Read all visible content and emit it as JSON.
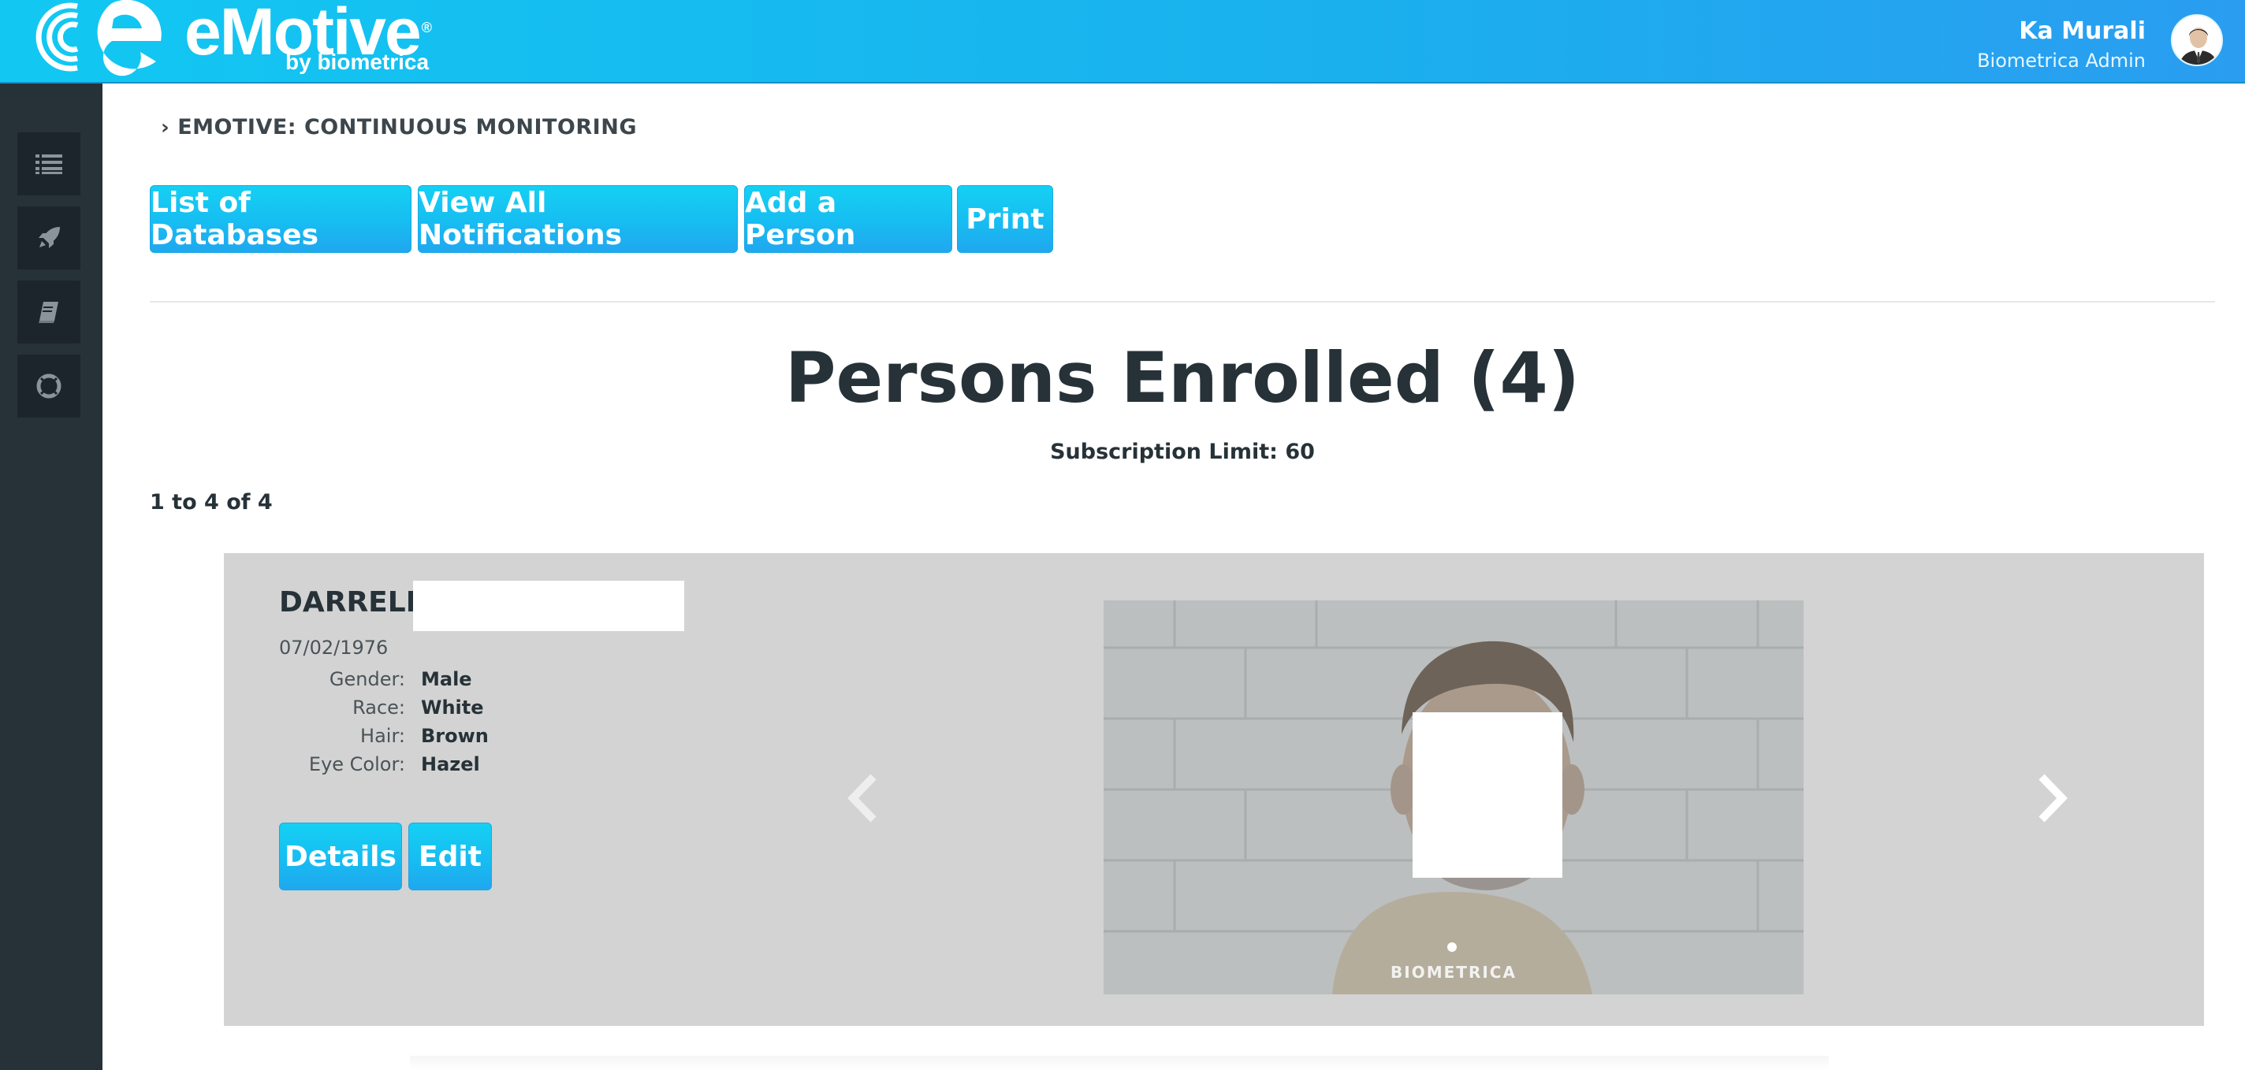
{
  "header": {
    "brand": "eMotive",
    "brand_reg": "®",
    "brand_sub": "by biometrica",
    "user_name": "Ka Murali",
    "user_role": "Biometrica Admin"
  },
  "sidebar": {
    "items": [
      {
        "icon": "list-icon"
      },
      {
        "icon": "rocket-icon"
      },
      {
        "icon": "book-icon"
      },
      {
        "icon": "lifebuoy-icon"
      }
    ]
  },
  "breadcrumb": {
    "label": "EMOTIVE: CONTINUOUS MONITORING"
  },
  "toolbar": {
    "list_databases": "List of Databases",
    "view_notifications": "View All Notifications",
    "add_person": "Add a Person",
    "print": "Print"
  },
  "page": {
    "title": "Persons Enrolled (4)",
    "subscription": "Subscription Limit: 60",
    "count": "1 to 4 of 4"
  },
  "person": {
    "first_name": "DARRELL",
    "dob": "07/02/1976",
    "attributes": [
      {
        "label": "Gender:",
        "value": "Male"
      },
      {
        "label": "Race:",
        "value": "White"
      },
      {
        "label": "Hair:",
        "value": "Brown"
      },
      {
        "label": "Eye Color:",
        "value": "Hazel"
      }
    ],
    "details_label": "Details",
    "edit_label": "Edit",
    "photo_watermark": "BIOMETRICA"
  },
  "colors": {
    "header_start": "#12c8f2",
    "header_end": "#2a9df0",
    "button": "#16bff2",
    "sidebar": "#263238",
    "card": "#d3d3d3"
  }
}
